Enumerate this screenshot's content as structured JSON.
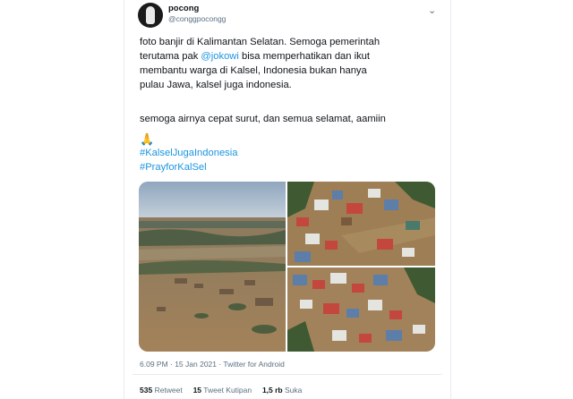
{
  "tweet": {
    "display_name": "pocong",
    "handle": "@conggpocongg",
    "menu_icon": "more-icon",
    "line1": "foto banjir di Kalimantan Selatan. Semoga pemerintah",
    "line2_prefix": "terutama pak ",
    "mention": "@jokowi",
    "line2_suffix": "  bisa memperhatikan dan ikut",
    "line3": "membantu warga di Kalsel, Indonesia bukan hanya",
    "line4": "pulau Jawa, kalsel juga indonesia.",
    "line5": "semoga airnya cepat surut, dan semua selamat, aamiin",
    "emoji": "🙏",
    "hashtag1": "#KalselJugaIndonesia",
    "hashtag2": "#PrayforKalSel",
    "timestamp": "6.09 PM · 15 Jan 2021 · Twitter for Android",
    "retweets_count": "535",
    "retweets_label": "Retweet",
    "quotes_count": "15",
    "quotes_label": "Tweet Kutipan",
    "likes_count": "1,5 rb",
    "likes_label": "Suka"
  },
  "colors": {
    "link": "#1b95e0",
    "secondary": "#5b7083",
    "text": "#0f1419"
  }
}
